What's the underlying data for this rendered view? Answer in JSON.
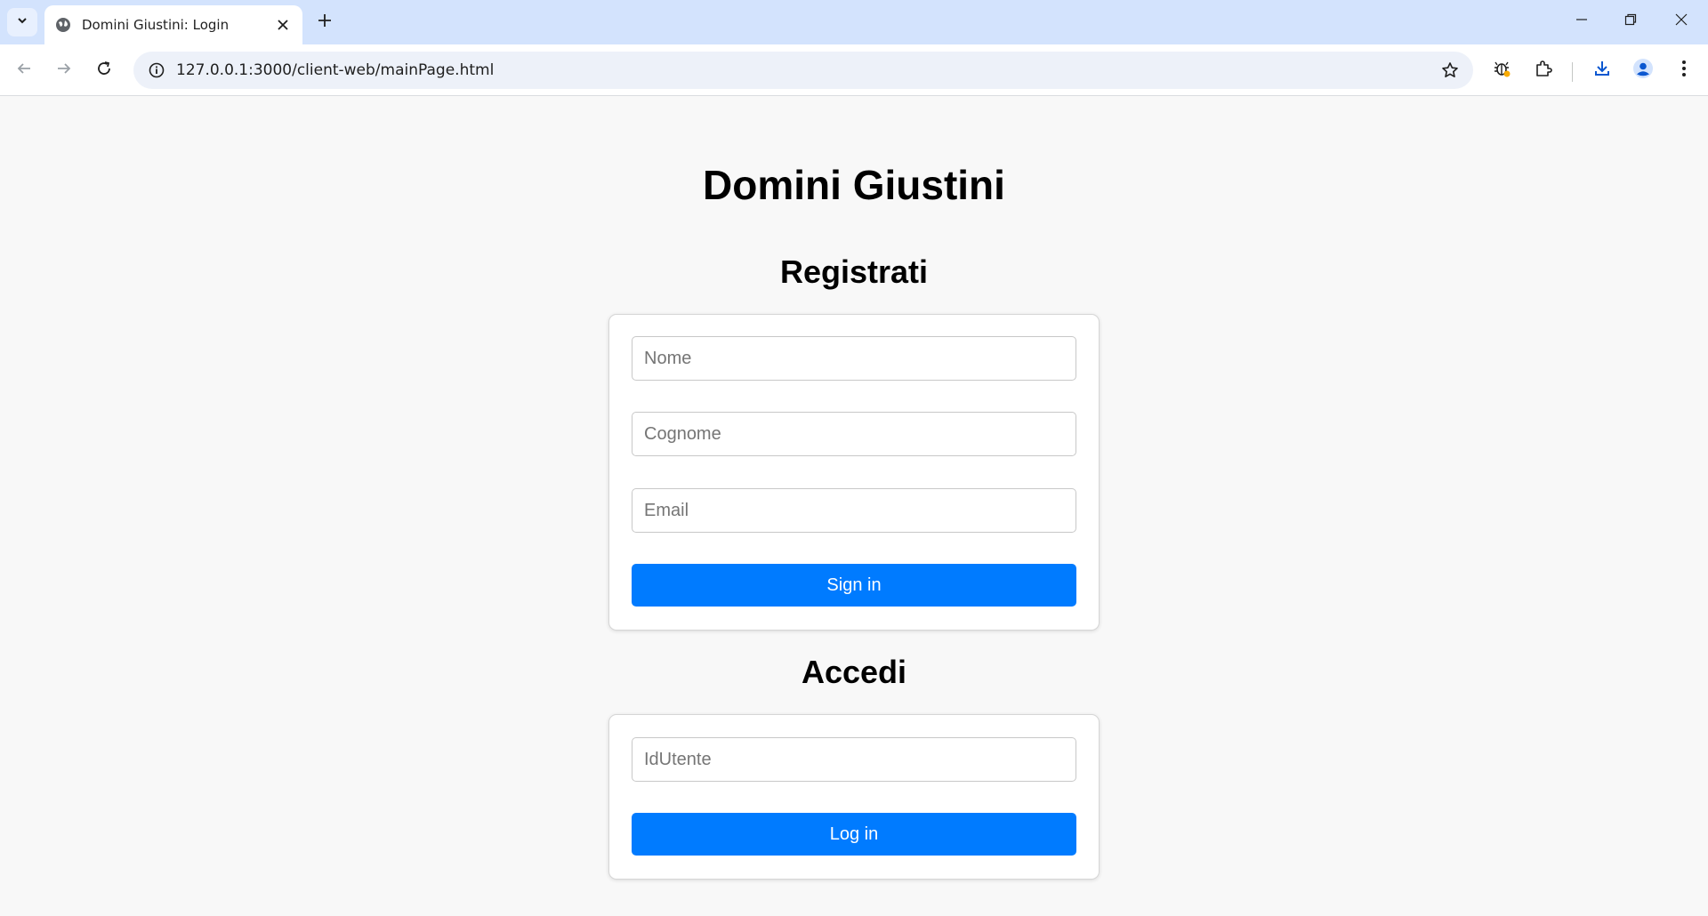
{
  "browser": {
    "tab_title": "Domini Giustini: Login",
    "url": "127.0.0.1:3000/client-web/mainPage.html"
  },
  "page": {
    "title": "Domini Giustini",
    "register": {
      "heading": "Registrati",
      "name_placeholder": "Nome",
      "surname_placeholder": "Cognome",
      "email_placeholder": "Email",
      "submit_label": "Sign in"
    },
    "login": {
      "heading": "Accedi",
      "userid_placeholder": "IdUtente",
      "submit_label": "Log in"
    }
  },
  "colors": {
    "accent": "#007bff",
    "page_background": "#f8f8f8",
    "tabbar_background": "#d3e3fd"
  }
}
